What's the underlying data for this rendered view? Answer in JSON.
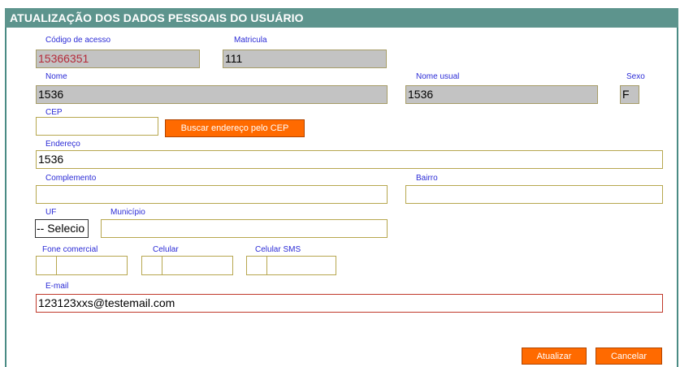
{
  "title": "ATUALIZAÇÃO DOS DADOS PESSOAIS DO USUÁRIO",
  "fields": {
    "codigo_acesso": {
      "label": "Código de acesso",
      "value": "15366351"
    },
    "matricula": {
      "label": "Matricula",
      "value": "111"
    },
    "nome": {
      "label": "Nome",
      "value": "1536"
    },
    "nome_usual": {
      "label": "Nome usual",
      "value": "1536"
    },
    "sexo": {
      "label": "Sexo",
      "value": "F"
    },
    "cep": {
      "label": "CEP",
      "value": ""
    },
    "endereco": {
      "label": "Endereço",
      "value": "1536"
    },
    "complemento": {
      "label": "Complemento",
      "value": ""
    },
    "bairro": {
      "label": "Bairro",
      "value": ""
    },
    "uf": {
      "label": "UF",
      "value": "-- Selecio"
    },
    "municipio": {
      "label": "Município",
      "value": ""
    },
    "fone_comercial": {
      "label": "Fone comercial"
    },
    "celular": {
      "label": "Celular"
    },
    "celular_sms": {
      "label": "Celular SMS"
    },
    "email": {
      "label": "E-mail",
      "value": "123123xxs@testemail.com"
    }
  },
  "buttons": {
    "buscar_cep": "Buscar endereço pelo CEP",
    "atualizar": "Atualizar",
    "cancelar": "Cancelar"
  },
  "colors": {
    "title_bar": "#5d948d",
    "label": "#2b2bd6",
    "button": "#ff6a00",
    "readonly_bg": "#c3c3c3",
    "field_border": "#b7a74f"
  }
}
